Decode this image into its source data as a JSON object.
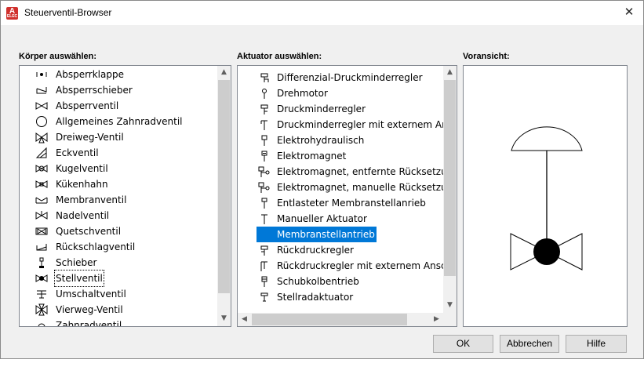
{
  "window": {
    "title": "Steuerventil-Browser",
    "app_icon_letter": "A",
    "app_icon_sub": "ELEC",
    "close_glyph": "✕"
  },
  "body_section": {
    "label": "Körper auswählen:",
    "items": [
      {
        "label": "Absperrklappe",
        "icon": "butterfly-valve-icon"
      },
      {
        "label": "Absperrschieber",
        "icon": "gate-valve-icon"
      },
      {
        "label": "Absperrventil",
        "icon": "globe-valve-icon"
      },
      {
        "label": "Allgemeines Zahnradventil",
        "icon": "gear-valve-icon"
      },
      {
        "label": "Dreiweg-Ventil",
        "icon": "three-way-valve-icon"
      },
      {
        "label": "Eckventil",
        "icon": "angle-valve-icon"
      },
      {
        "label": "Kugelventil",
        "icon": "ball-valve-icon"
      },
      {
        "label": "Kükenhahn",
        "icon": "plug-valve-icon"
      },
      {
        "label": "Membranventil",
        "icon": "diaphragm-valve-icon"
      },
      {
        "label": "Nadelventil",
        "icon": "needle-valve-icon"
      },
      {
        "label": "Quetschventil",
        "icon": "pinch-valve-icon"
      },
      {
        "label": "Rückschlagventil",
        "icon": "check-valve-icon"
      },
      {
        "label": "Schieber",
        "icon": "slide-valve-icon"
      },
      {
        "label": "Stellventil",
        "icon": "control-valve-icon",
        "selected": true
      },
      {
        "label": "Umschaltventil",
        "icon": "switch-valve-icon"
      },
      {
        "label": "Vierweg-Ventil",
        "icon": "four-way-valve-icon"
      },
      {
        "label": "Zahnradventil",
        "icon": "gear-wheel-valve-icon"
      }
    ]
  },
  "actuator_section": {
    "label": "Aktuator auswählen:",
    "items": [
      {
        "label": "Differenzial-Druckminderregler",
        "icon": "differential-regulator-icon"
      },
      {
        "label": "Drehmotor",
        "icon": "rotary-motor-icon"
      },
      {
        "label": "Druckminderregler",
        "icon": "pressure-regulator-icon"
      },
      {
        "label": "Druckminderregler mit externem Ans",
        "icon": "external-regulator-icon"
      },
      {
        "label": "Elektrohydraulisch",
        "icon": "electrohydraulic-icon"
      },
      {
        "label": "Elektromagnet",
        "icon": "solenoid-icon"
      },
      {
        "label": "Elektromagnet, entfernte Rücksetzur",
        "icon": "solenoid-remote-reset-icon"
      },
      {
        "label": "Elektromagnet, manuelle Rücksetzur",
        "icon": "solenoid-manual-reset-icon"
      },
      {
        "label": "Entlasteter Membranstellanrieb",
        "icon": "balanced-diaphragm-icon"
      },
      {
        "label": "Manueller Aktuator",
        "icon": "manual-actuator-icon"
      },
      {
        "label": "Membranstellantrieb",
        "icon": "diaphragm-actuator-icon",
        "selected": true
      },
      {
        "label": "Rückdruckregler",
        "icon": "back-pressure-regulator-icon"
      },
      {
        "label": "Rückdruckregler mit externem Ansch",
        "icon": "back-pressure-external-icon"
      },
      {
        "label": "Schubkolbentrieb",
        "icon": "piston-drive-icon"
      },
      {
        "label": "Stellradaktuator",
        "icon": "handwheel-actuator-icon"
      },
      {
        "label": "",
        "icon": "partial-item-icon"
      }
    ]
  },
  "preview_section": {
    "label": "Voransicht:",
    "preview_icon": "diaphragm-control-valve-preview"
  },
  "buttons": {
    "ok": "OK",
    "cancel": "Abbrechen",
    "help": "Hilfe"
  },
  "scroll": {
    "up_arrow": "▲",
    "down_arrow": "▼",
    "left_arrow": "◀",
    "right_arrow": "▶"
  },
  "colors": {
    "selection": "#0078d7",
    "dialog_bg": "#f0f0f0",
    "app_icon": "#d0312d"
  }
}
